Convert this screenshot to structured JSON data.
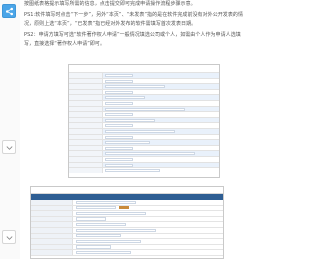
{
  "article": {
    "p1": "按图纸表格提示填写所需的信息，点击提交即可完成申请操作流程步骤示意。",
    "p2": "PS1:软件填写时点击“下一步”，另外“本页”、“未发表”指的是在软件完成前没有对外公开发表的情况，原则上选“本页”，“已发表”指已经对外发布的软件需填写首次发表日期。",
    "p3": "PS2：申请方填写可选“软件著作权人申请”一般情况填选公司或个人，如需由个人作为申请人选填写，直接选择“著作权人申请”即可。"
  },
  "icons": {
    "share": "share-icon",
    "fold": "chevron-icon"
  },
  "colors": {
    "form_header": "#2e5e93",
    "accent_tag": "#c98a3a",
    "label_bg": "#eef2f7"
  }
}
